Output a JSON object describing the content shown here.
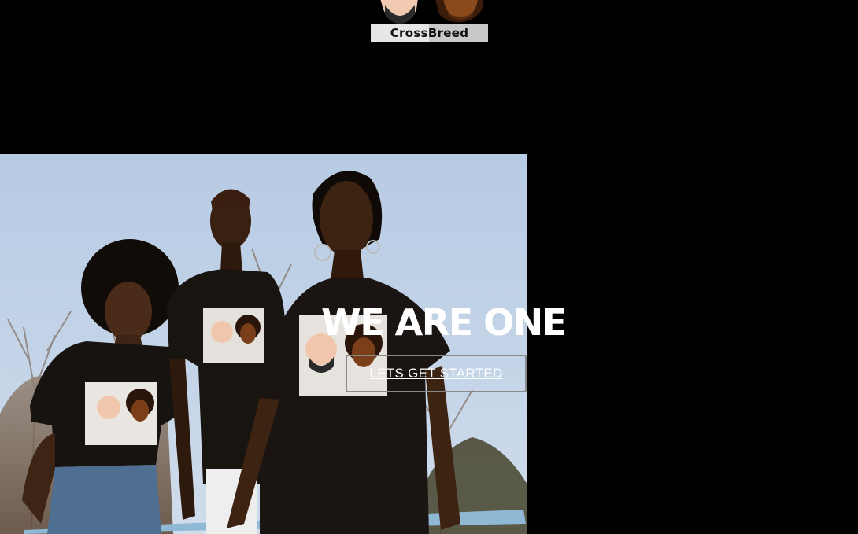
{
  "header": {
    "logo": {
      "text": "CrossBreed",
      "icon": "crossbreed-faces-logo-icon"
    }
  },
  "hero": {
    "heading": "WE ARE ONE",
    "cta_label": "LETS GET STARTED",
    "photo": "three-models-wearing-crossbreed-tshirts-image"
  },
  "colors": {
    "background": "#000000",
    "text": "#ffffff",
    "button_border": "#8a8a8a",
    "sky": "#c2d3e6"
  }
}
